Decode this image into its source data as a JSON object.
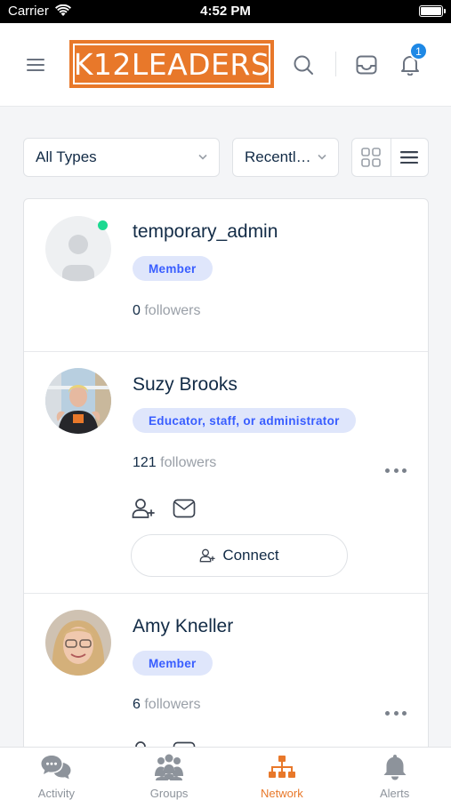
{
  "status_bar": {
    "carrier": "Carrier",
    "time": "4:52 PM"
  },
  "header": {
    "logo_text": "K12LEADERS",
    "notification_count": "1"
  },
  "filters": {
    "type_select": "All Types",
    "sort_select": "Recently Active"
  },
  "members": [
    {
      "name": "temporary_admin",
      "type": "Member",
      "followers_count": "0",
      "followers_label": " followers",
      "online": true
    },
    {
      "name": "Suzy Brooks",
      "type": "Educator, staff, or administrator",
      "followers_count": "121",
      "followers_label": " followers",
      "connect_label": "Connect"
    },
    {
      "name": "Amy Kneller",
      "type": "Member",
      "followers_count": "6",
      "followers_label": " followers"
    }
  ],
  "tabs": [
    {
      "label": "Activity",
      "icon": "chat-bubbles-icon"
    },
    {
      "label": "Groups",
      "icon": "group-icon"
    },
    {
      "label": "Network",
      "icon": "network-icon",
      "active": true
    },
    {
      "label": "Alerts",
      "icon": "bell-icon"
    }
  ],
  "colors": {
    "brand": "#e8782a",
    "badge": "#1e88e5",
    "type_pill_bg": "#dfe6fb",
    "type_pill_text": "#385dff",
    "online": "#1cd991"
  }
}
